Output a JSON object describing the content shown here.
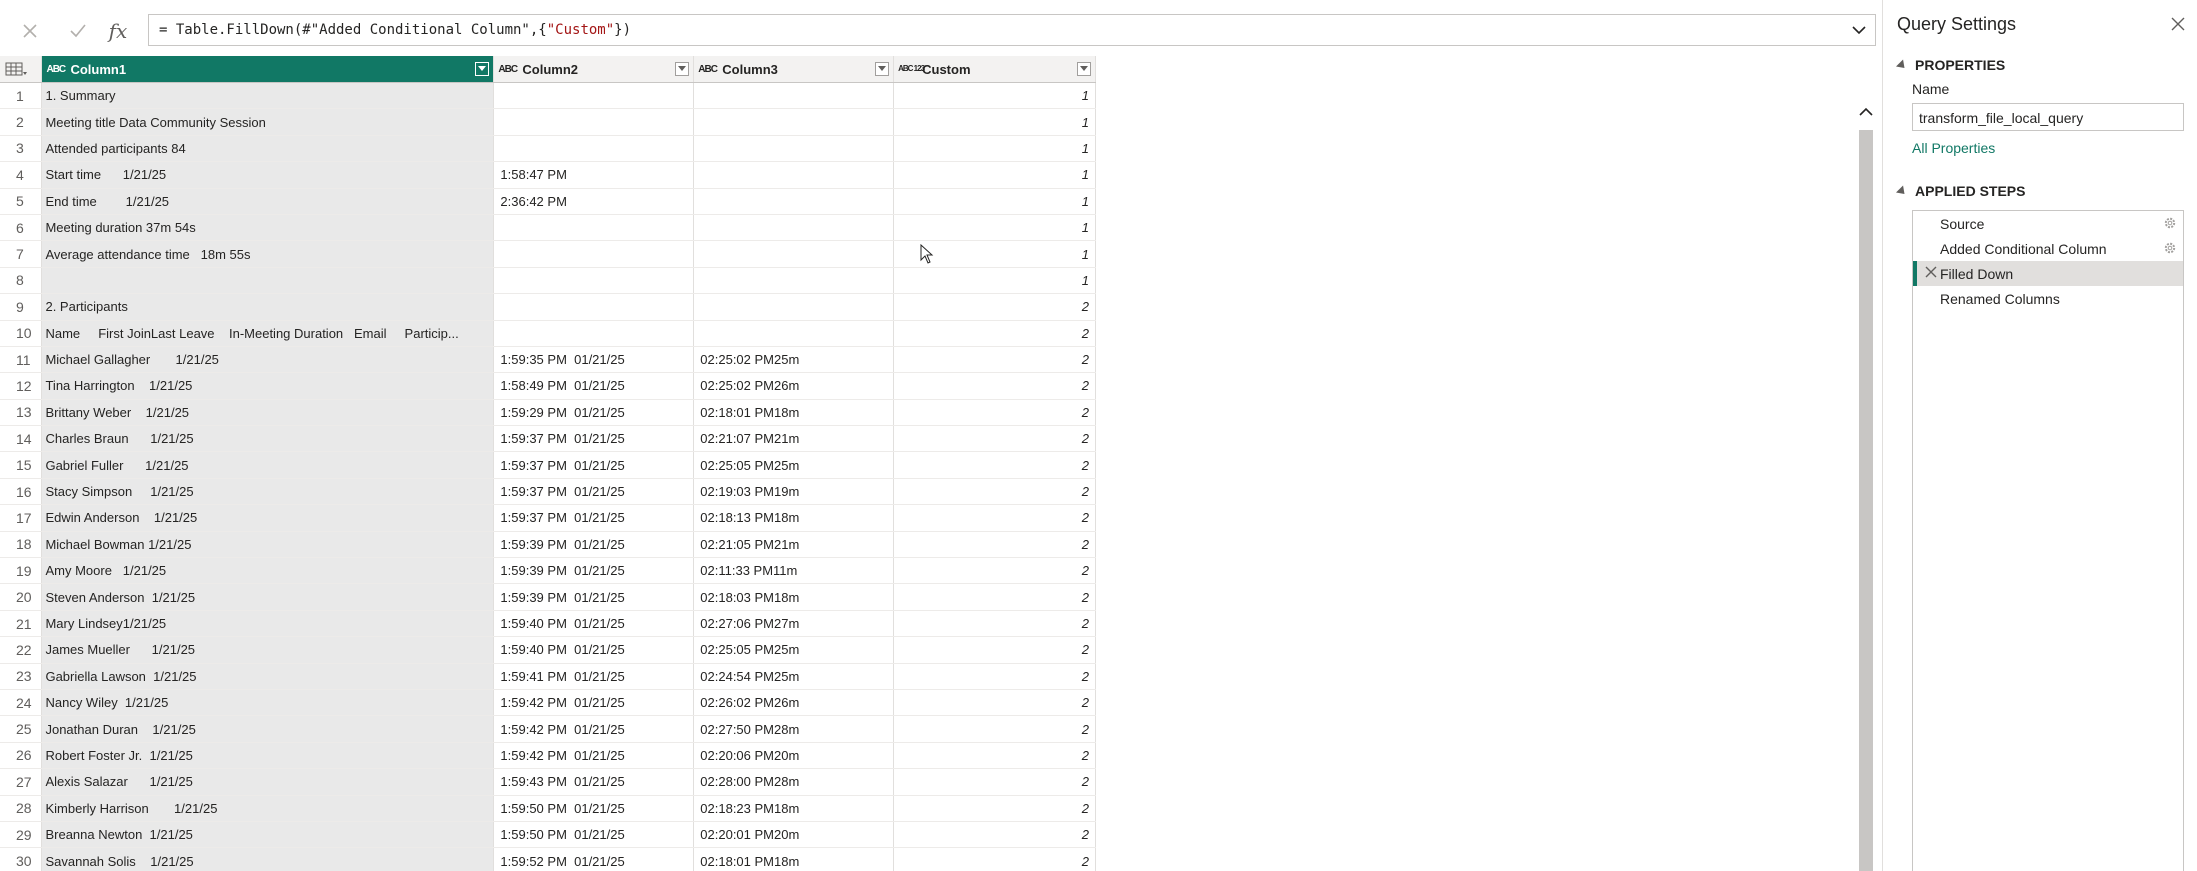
{
  "formula": {
    "cancel_icon": "close-icon",
    "commit_icon": "check-icon",
    "fx_label": "fx",
    "prefix": "= Table.FillDown(#\"Added Conditional Column\",{",
    "string": "\"Custom\"",
    "suffix": "})"
  },
  "columns": [
    {
      "type": "ABC",
      "name": "Column1"
    },
    {
      "type": "ABC",
      "name": "Column2"
    },
    {
      "type": "ABC",
      "name": "Column3"
    },
    {
      "type": "ABC 123",
      "name": "Custom"
    }
  ],
  "rows": [
    {
      "n": "1",
      "c1": "1. Summary",
      "c2": "",
      "c3": "",
      "c4": "1"
    },
    {
      "n": "2",
      "c1": "Meeting title Data Community Session",
      "c2": "",
      "c3": "",
      "c4": "1"
    },
    {
      "n": "3",
      "c1": "Attended participants 84",
      "c2": "",
      "c3": "",
      "c4": "1"
    },
    {
      "n": "4",
      "c1": "Start time      1/21/25",
      "c2": "1:58:47 PM",
      "c3": "",
      "c4": "1"
    },
    {
      "n": "5",
      "c1": "End time        1/21/25",
      "c2": "2:36:42 PM",
      "c3": "",
      "c4": "1"
    },
    {
      "n": "6",
      "c1": "Meeting duration 37m 54s",
      "c2": "",
      "c3": "",
      "c4": "1"
    },
    {
      "n": "7",
      "c1": "Average attendance time   18m 55s",
      "c2": "",
      "c3": "",
      "c4": "1"
    },
    {
      "n": "8",
      "c1": "",
      "c2": "",
      "c3": "",
      "c4": "1"
    },
    {
      "n": "9",
      "c1": "2. Participants",
      "c2": "",
      "c3": "",
      "c4": "2"
    },
    {
      "n": "10",
      "c1": "Name     First JoinLast Leave    In-Meeting Duration   Email     Particip...",
      "c2": "",
      "c3": "",
      "c4": "2"
    },
    {
      "n": "11",
      "c1": "Michael Gallagher       1/21/25",
      "c2": "1:59:35 PM  01/21/25",
      "c3": "02:25:02 PM25m",
      "c4": "2"
    },
    {
      "n": "12",
      "c1": "Tina Harrington    1/21/25",
      "c2": "1:58:49 PM  01/21/25",
      "c3": "02:25:02 PM26m",
      "c4": "2"
    },
    {
      "n": "13",
      "c1": "Brittany Weber    1/21/25",
      "c2": "1:59:29 PM  01/21/25",
      "c3": "02:18:01 PM18m",
      "c4": "2"
    },
    {
      "n": "14",
      "c1": "Charles Braun      1/21/25",
      "c2": "1:59:37 PM  01/21/25",
      "c3": "02:21:07 PM21m",
      "c4": "2"
    },
    {
      "n": "15",
      "c1": "Gabriel Fuller      1/21/25",
      "c2": "1:59:37 PM  01/21/25",
      "c3": "02:25:05 PM25m",
      "c4": "2"
    },
    {
      "n": "16",
      "c1": "Stacy Simpson     1/21/25",
      "c2": "1:59:37 PM  01/21/25",
      "c3": "02:19:03 PM19m",
      "c4": "2"
    },
    {
      "n": "17",
      "c1": "Edwin Anderson    1/21/25",
      "c2": "1:59:37 PM  01/21/25",
      "c3": "02:18:13 PM18m",
      "c4": "2"
    },
    {
      "n": "18",
      "c1": "Michael Bowman 1/21/25",
      "c2": "1:59:39 PM  01/21/25",
      "c3": "02:21:05 PM21m",
      "c4": "2"
    },
    {
      "n": "19",
      "c1": "Amy Moore   1/21/25",
      "c2": "1:59:39 PM  01/21/25",
      "c3": "02:11:33 PM11m",
      "c4": "2"
    },
    {
      "n": "20",
      "c1": "Steven Anderson  1/21/25",
      "c2": "1:59:39 PM  01/21/25",
      "c3": "02:18:03 PM18m",
      "c4": "2"
    },
    {
      "n": "21",
      "c1": "Mary Lindsey1/21/25",
      "c2": "1:59:40 PM  01/21/25",
      "c3": "02:27:06 PM27m",
      "c4": "2"
    },
    {
      "n": "22",
      "c1": "James Mueller      1/21/25",
      "c2": "1:59:40 PM  01/21/25",
      "c3": "02:25:05 PM25m",
      "c4": "2"
    },
    {
      "n": "23",
      "c1": "Gabriella Lawson  1/21/25",
      "c2": "1:59:41 PM  01/21/25",
      "c3": "02:24:54 PM25m",
      "c4": "2"
    },
    {
      "n": "24",
      "c1": "Nancy Wiley  1/21/25",
      "c2": "1:59:42 PM  01/21/25",
      "c3": "02:26:02 PM26m",
      "c4": "2"
    },
    {
      "n": "25",
      "c1": "Jonathan Duran    1/21/25",
      "c2": "1:59:42 PM  01/21/25",
      "c3": "02:27:50 PM28m",
      "c4": "2"
    },
    {
      "n": "26",
      "c1": "Robert Foster Jr.  1/21/25",
      "c2": "1:59:42 PM  01/21/25",
      "c3": "02:20:06 PM20m",
      "c4": "2"
    },
    {
      "n": "27",
      "c1": "Alexis Salazar      1/21/25",
      "c2": "1:59:43 PM  01/21/25",
      "c3": "02:28:00 PM28m",
      "c4": "2"
    },
    {
      "n": "28",
      "c1": "Kimberly Harrison       1/21/25",
      "c2": "1:59:50 PM  01/21/25",
      "c3": "02:18:23 PM18m",
      "c4": "2"
    },
    {
      "n": "29",
      "c1": "Breanna Newton  1/21/25",
      "c2": "1:59:50 PM  01/21/25",
      "c3": "02:20:01 PM20m",
      "c4": "2"
    },
    {
      "n": "30",
      "c1": "Savannah Solis    1/21/25",
      "c2": "1:59:52 PM  01/21/25",
      "c3": "02:18:01 PM18m",
      "c4": "2"
    }
  ],
  "settings": {
    "title": "Query Settings",
    "properties_header": "PROPERTIES",
    "name_label": "Name",
    "name_value": "transform_file_local_query",
    "all_properties": "All Properties",
    "applied_steps_header": "APPLIED STEPS",
    "steps": [
      "Source",
      "Added Conditional Column",
      "Filled Down",
      "Renamed Columns"
    ],
    "active_step": "Filled Down"
  },
  "colors": {
    "accent": "#117865",
    "column_quality": "#01b8aa",
    "error_bar": "#e66c37"
  }
}
